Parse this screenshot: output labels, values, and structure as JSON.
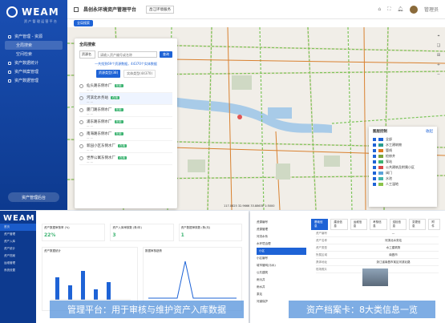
{
  "app": {
    "logo": "WEAM",
    "logo_sub": "资 产 管 理 运 营 平 台",
    "title": "昌创永环境资产管理平台",
    "city_select": "昌江环境服务",
    "user": "管理员",
    "tab": "全局搜索"
  },
  "sidebar": {
    "items": [
      {
        "label": "资产管理 - 资源",
        "type": "group"
      },
      {
        "label": "全局搜索",
        "type": "sub",
        "active": true
      },
      {
        "label": "空间检索",
        "type": "sub"
      },
      {
        "label": "资产数据统计",
        "type": "group"
      },
      {
        "label": "资产档案管理",
        "type": "group"
      },
      {
        "label": "资产数据管理",
        "type": "group"
      }
    ],
    "bottom_button": "资产管理后台"
  },
  "panel": {
    "title": "全局搜索",
    "select": "资源名",
    "placeholder": "请输入资产编号或名称",
    "search_btn": "查询",
    "count": "一共找到69个资源数据，44370个实体数据",
    "filter_on": "资源类型(38)",
    "filter_off": "实体类型(44370)",
    "items": [
      {
        "name": "仙头路东侧水厂",
        "tag": "在用",
        "sub": "— —"
      },
      {
        "name": "河滨北水务站",
        "tag": "在用",
        "sub": "— —"
      },
      {
        "name": "厦门路东侧水厂",
        "tag": "在用",
        "sub": "— —"
      },
      {
        "name": "浦东路东侧水厂",
        "tag": "在用",
        "sub": "— —"
      },
      {
        "name": "南海路东侧水厂",
        "tag": "在用",
        "sub": "— —"
      },
      {
        "name": "新园小区东侧水厂",
        "tag": "在用",
        "sub": "— —"
      },
      {
        "name": "世界公寓东侧水厂",
        "tag": "在用",
        "sub": "— —"
      }
    ]
  },
  "legend": {
    "title": "图层控制",
    "action": "收起",
    "rows": [
      {
        "label": "全部",
        "color": "#1e63d6"
      },
      {
        "label": "水工建筑物",
        "color": "#2a9d8f"
      },
      {
        "label": "管线",
        "color": "#e07a1f"
      },
      {
        "label": "检修井",
        "color": "#7aa33c"
      },
      {
        "label": "泵站",
        "color": "#3cb371"
      },
      {
        "label": "公共建筑及附属小区",
        "color": "#d94a4a"
      },
      {
        "label": "阀门",
        "color": "#5aa2d9"
      },
      {
        "label": "水池",
        "color": "#44b4a8"
      },
      {
        "label": "人工湿地",
        "color": "#8bc34a"
      }
    ]
  },
  "map": {
    "scale": "117.0825 32.9666 33.8863E 1:5000"
  },
  "card1": {
    "logo": "WEAM",
    "nav": [
      "首页",
      "资产管理",
      "资产入库",
      "资产统计",
      "资产档案",
      "运维管理",
      "系统设置"
    ],
    "stats": [
      {
        "label": "资产数据审核率 (%)",
        "value": "22%"
      },
      {
        "label": "资产入库审核数 (条/年)",
        "value": "3"
      },
      {
        "label": "资产数据审核数 (条/月)",
        "value": "1"
      }
    ],
    "chart1_title": "资产数据统计",
    "chart2_title": "数据审核趋势",
    "caption": "管理平台：用于审核与维护资产入库数据"
  },
  "card2": {
    "tree": [
      "资源编号",
      "资源管理",
      "河流水系",
      "水环境治理",
      "小区",
      "小区编号",
      "城市管网(污水)",
      "公共建筑",
      "雨污井",
      "雨水井",
      "泵站",
      "河道保护"
    ],
    "tabs": [
      "基础信息",
      "建设信息",
      "运维信息",
      "考核信息",
      "巡检信息",
      "变更信息",
      "附件"
    ],
    "kv": [
      {
        "k": "资产编号",
        "v": "—"
      },
      {
        "k": "资产名称",
        "v": "河滨北水务站"
      },
      {
        "k": "资产类型",
        "v": "水工建筑物"
      },
      {
        "k": "所属区域",
        "v": "南昌市"
      },
      {
        "k": "具体地址",
        "v": "浙江省南昌市某区河滨北路"
      },
      {
        "k": "现场照片",
        "v": ""
      }
    ],
    "caption": "资产档案卡：8大类信息一览"
  }
}
